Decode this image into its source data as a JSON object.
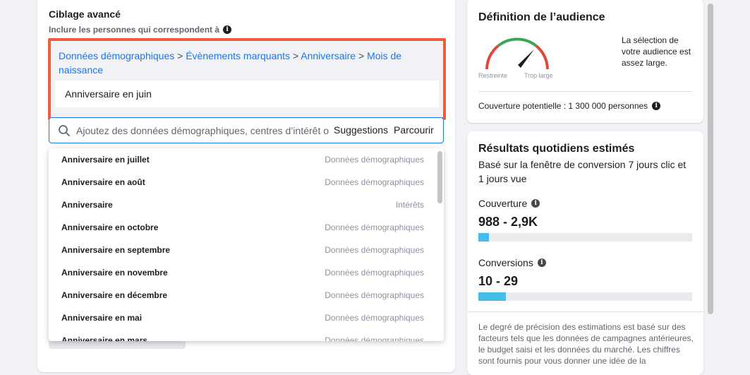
{
  "targeting": {
    "title": "Ciblage avancé",
    "subtitle": "Inclure les personnes qui correspondent à",
    "breadcrumb": [
      "Données démographiques",
      "Évènements marquants",
      "Anniversaire",
      "Mois de naissance"
    ],
    "breadcrumb_separator": ">",
    "selected_item": "Anniversaire en juin",
    "search": {
      "placeholder": "Ajoutez des données démographiques, centres d’intérêt o",
      "suggestions_label": "Suggestions",
      "browse_label": "Parcourir"
    },
    "dropdown": [
      {
        "label": "Anniversaire en juillet",
        "category": "Données démographiques"
      },
      {
        "label": "Anniversaire en août",
        "category": "Données démographiques"
      },
      {
        "label": "Anniversaire",
        "category": "Intérêts"
      },
      {
        "label": "Anniversaire en octobre",
        "category": "Données démographiques"
      },
      {
        "label": "Anniversaire en septembre",
        "category": "Données démographiques"
      },
      {
        "label": "Anniversaire en novembre",
        "category": "Données démographiques"
      },
      {
        "label": "Anniversaire en décembre",
        "category": "Données démographiques"
      },
      {
        "label": "Anniversaire en mai",
        "category": "Données démographiques"
      },
      {
        "label": "Anniversaire en mars",
        "category": "Données démographiques"
      }
    ]
  },
  "audience": {
    "title": "Définition de l’audience",
    "gauge_left_label": "Restreinte",
    "gauge_right_label": "Trop large",
    "description": "La sélection de votre audience est assez large.",
    "coverage": "Couverture potentielle : 1 300 000 personnes"
  },
  "results": {
    "title": "Résultats quotidiens estimés",
    "subtitle": "Basé sur la fenêtre de conversion 7 jours clic et 1 jours vue",
    "reach": {
      "label": "Couverture",
      "value": "988 - 2,9K",
      "fill_fraction": 0.05
    },
    "conversions": {
      "label": "Conversions",
      "value": "10 - 29",
      "fill_fraction": 0.13
    },
    "note": "Le degré de précision des estimations est basé sur des facteurs tels que les données de campagnes antérieures, le budget saisi et les données du marché. Les chiffres sont fournis pour vous donner une idée de la"
  },
  "colors": {
    "accent": "#1877f2",
    "highlight_border": "#f05a3f",
    "bar_fill": "#45bde8",
    "gauge_red": "#e0473d",
    "gauge_yellow": "#f5c33b",
    "gauge_green": "#3aa655"
  },
  "icons": {
    "info": "info-icon",
    "search": "search-icon"
  }
}
